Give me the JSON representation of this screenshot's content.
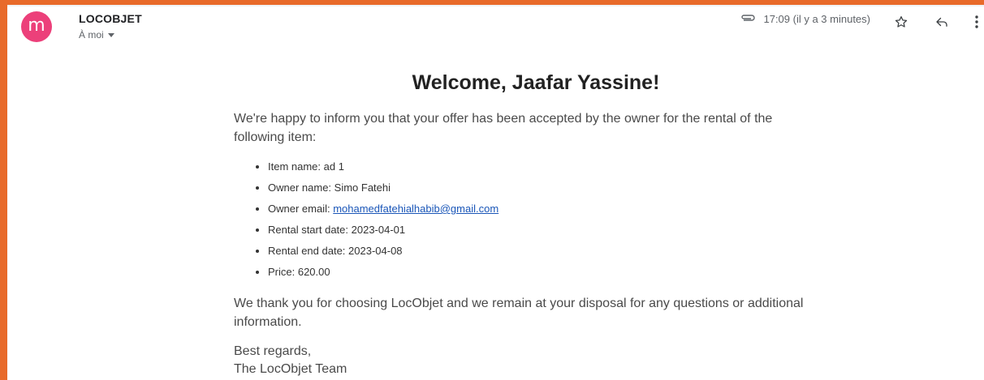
{
  "header": {
    "avatar_letter": "m",
    "sender": "LOCOBJET",
    "recipient": "À moi",
    "time": "17:09 (il y a 3 minutes)",
    "icons": [
      "attachment-icon",
      "star-icon",
      "reply-icon",
      "more-icon"
    ]
  },
  "body": {
    "title": "Welcome, Jaafar Yassine!",
    "intro": "We're happy to inform you that your offer has been accepted by the owner for the rental of the following item:",
    "items": [
      {
        "label": "Item name: ",
        "value": "ad 1"
      },
      {
        "label": "Owner name: ",
        "value": "Simo Fatehi"
      },
      {
        "label": "Owner email: ",
        "value": "mohamedfatehialhabib@gmail.com"
      },
      {
        "label": "Rental start date: ",
        "value": "2023-04-01"
      },
      {
        "label": "Rental end date: ",
        "value": "2023-04-08"
      },
      {
        "label": "Price: ",
        "value": "620.00"
      }
    ],
    "closing": "We thank you for choosing LocObjet and we remain at your disposal for any questions or additional information.",
    "regards": "Best regards,",
    "team": "The LocObjet Team"
  },
  "colors": {
    "frame": "#e86a2a",
    "avatar": "#ec407a",
    "link": "#1a56b8"
  }
}
